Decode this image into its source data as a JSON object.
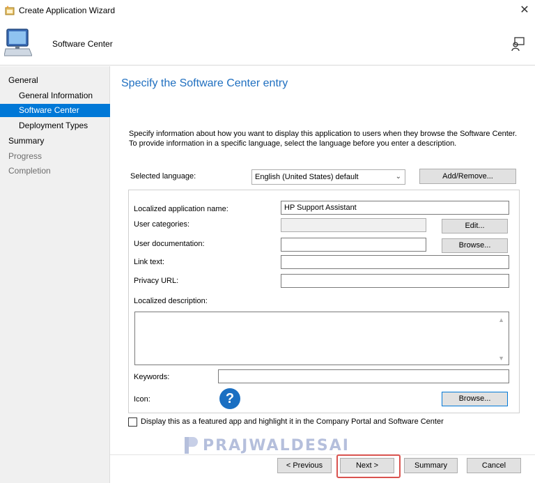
{
  "window": {
    "title": "Create Application Wizard",
    "close_glyph": "✕"
  },
  "header": {
    "title": "Software Center",
    "icon": "computer-icon",
    "feedback_icon": "feedback-icon"
  },
  "nav": {
    "items": [
      {
        "label": "General",
        "state": "normal"
      },
      {
        "label": "General Information",
        "state": "normal"
      },
      {
        "label": "Software Center",
        "state": "selected"
      },
      {
        "label": "Deployment Types",
        "state": "normal"
      },
      {
        "label": "Summary",
        "state": "normal"
      },
      {
        "label": "Progress",
        "state": "disabled"
      },
      {
        "label": "Completion",
        "state": "disabled"
      }
    ]
  },
  "main": {
    "heading": "Specify the Software Center entry",
    "description": "Specify information about how you want to display this application to users when they browse the Software Center. To provide information in a specific language, select the language before you enter a description.",
    "language_label": "Selected language:",
    "language_value": "English (United States) default",
    "add_remove_label": "Add/Remove...",
    "fields": {
      "app_name_label": "Localized application name:",
      "app_name_value": "HP Support Assistant",
      "categories_label": "User categories:",
      "categories_value": "",
      "categories_edit": "Edit...",
      "documentation_label": "User documentation:",
      "documentation_value": "",
      "documentation_browse": "Browse...",
      "link_text_label": "Link text:",
      "link_text_value": "",
      "privacy_label": "Privacy URL:",
      "privacy_value": "",
      "description_label": "Localized description:",
      "description_value": "",
      "keywords_label": "Keywords:",
      "keywords_value": "",
      "icon_label": "Icon:",
      "icon_glyph": "?",
      "icon_browse": "Browse..."
    },
    "featured_label": "Display this as a featured app and highlight it in the Company Portal and Software Center",
    "featured_checked": false
  },
  "watermark": {
    "text": "PRAJWALDESAI"
  },
  "footer": {
    "previous": "< Previous",
    "next": "Next >",
    "summary": "Summary",
    "cancel": "Cancel"
  },
  "colors": {
    "accent": "#0078d7",
    "heading": "#1f6fc0",
    "highlight": "#d9534f"
  }
}
